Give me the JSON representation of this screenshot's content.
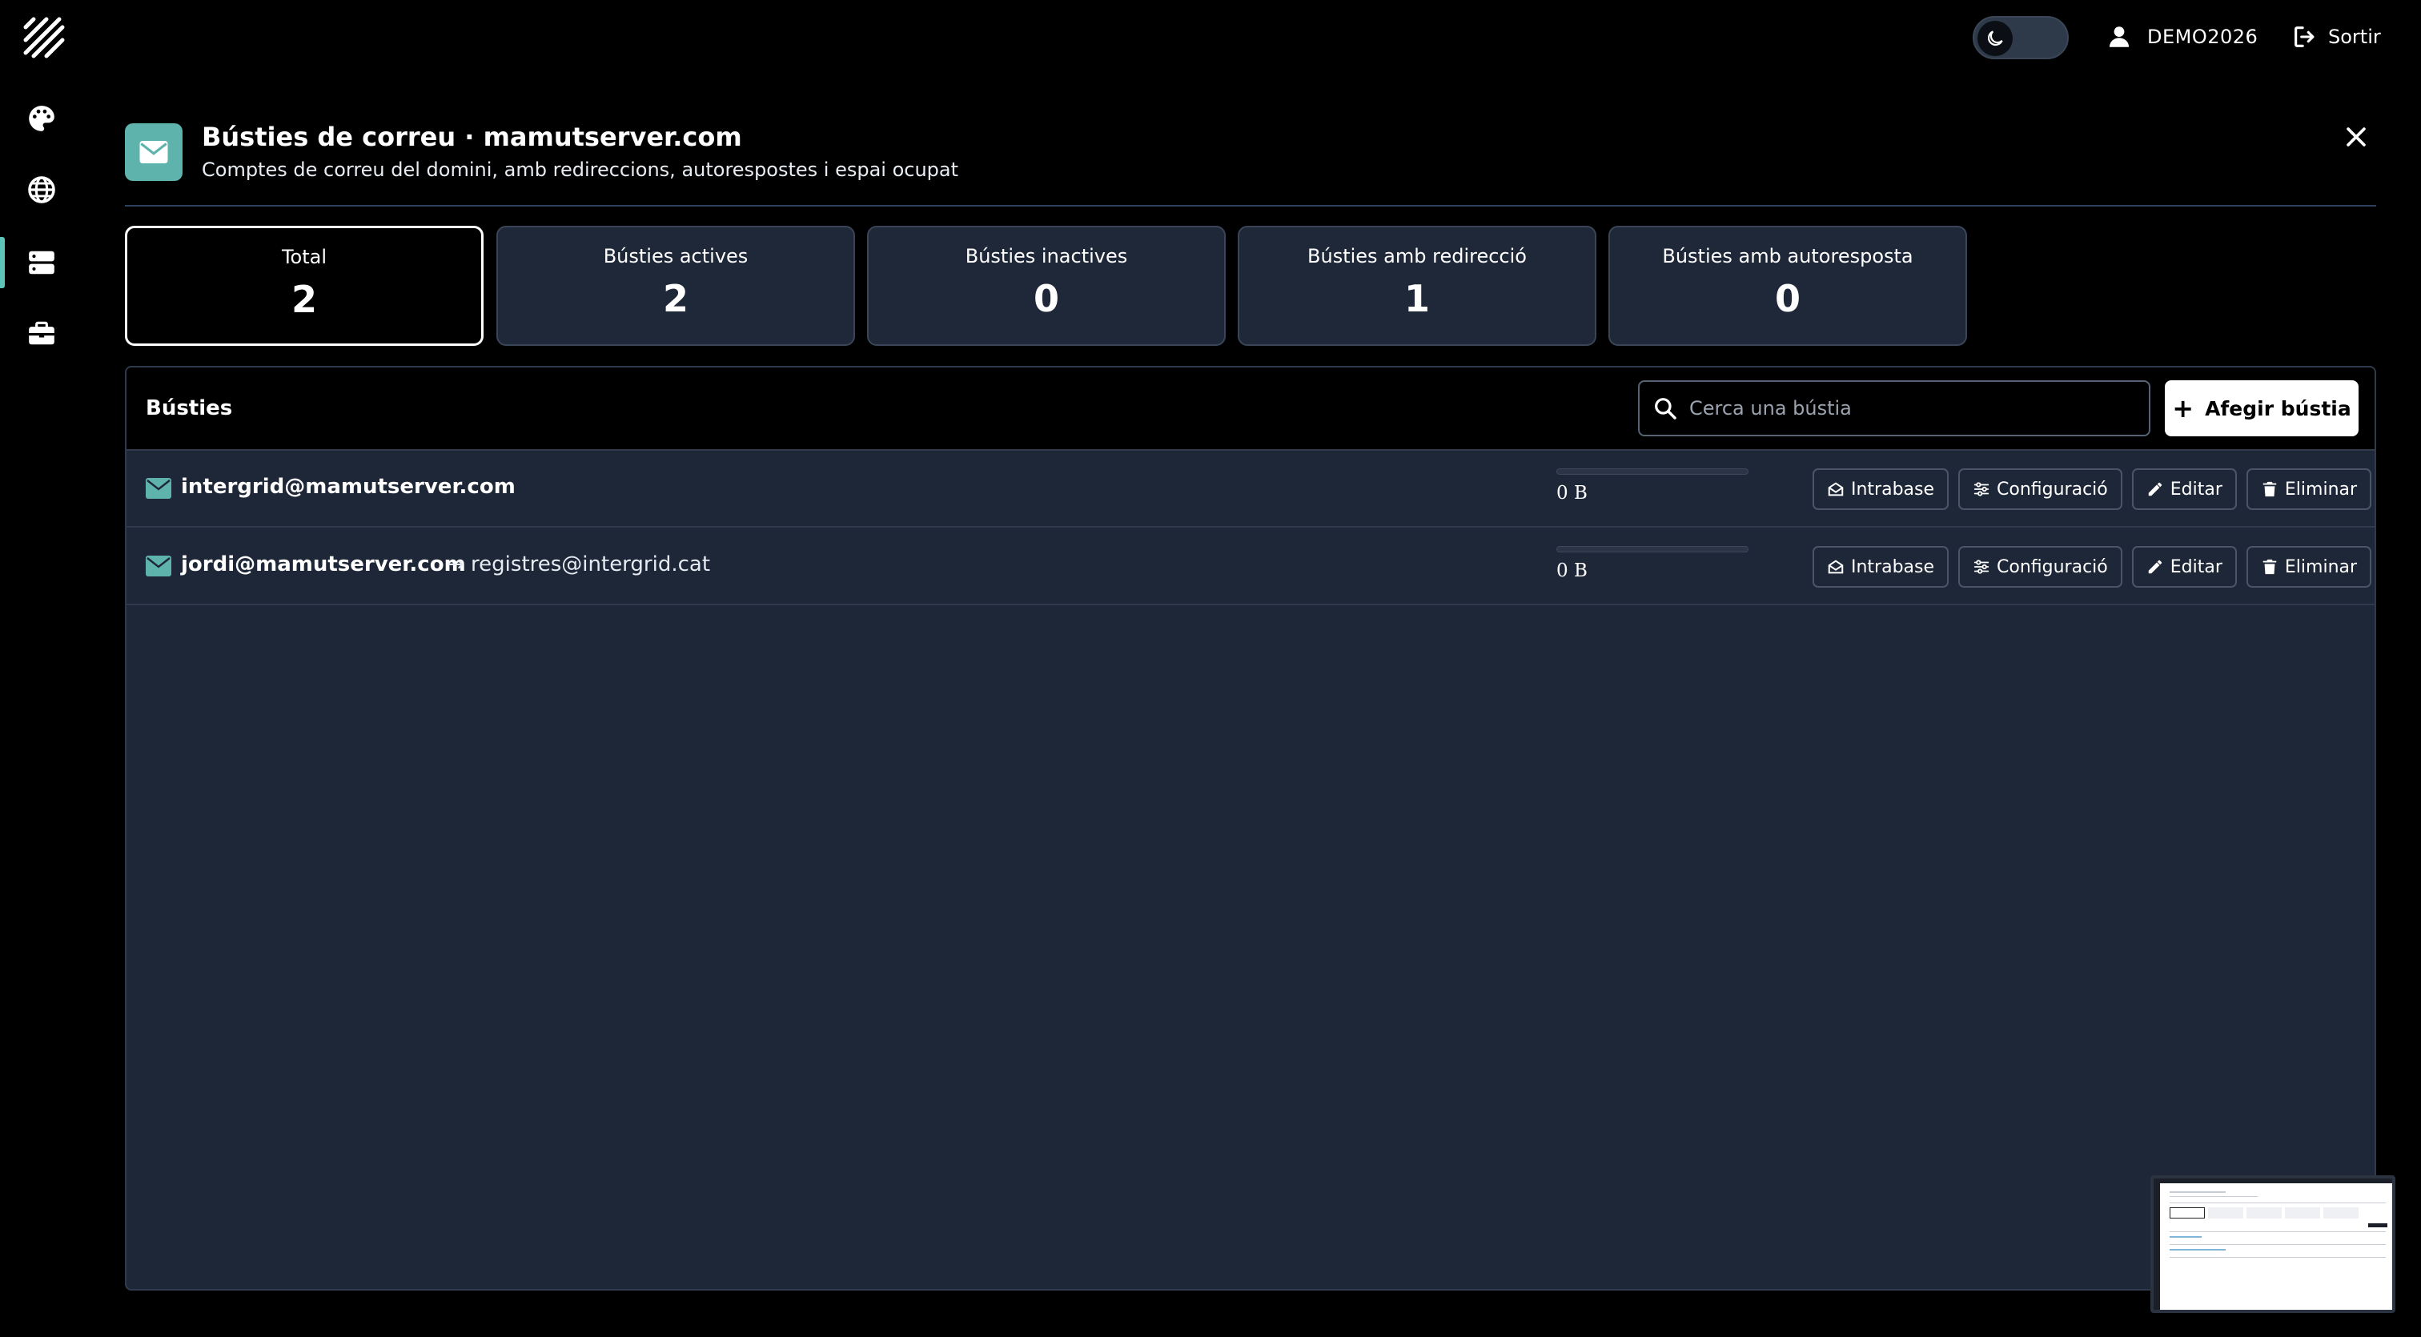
{
  "sidebar": {
    "logo": "brand-logo",
    "items": [
      {
        "icon": "palette-icon",
        "active": false
      },
      {
        "icon": "globe-icon",
        "active": false
      },
      {
        "icon": "server-icon",
        "active": true
      },
      {
        "icon": "briefcase-icon",
        "active": false
      }
    ]
  },
  "topbar": {
    "theme_toggle_icon": "moon-icon",
    "user_name": "DEMO2026",
    "logout_label": "Sortir"
  },
  "header": {
    "title": "Bústies de correu · mamutserver.com",
    "subtitle": "Comptes de correu del domini, amb redireccions, autorespostes i espai ocupat"
  },
  "stats": [
    {
      "label": "Total",
      "value": "2",
      "selected": true
    },
    {
      "label": "Bústies actives",
      "value": "2",
      "selected": false
    },
    {
      "label": "Bústies inactives",
      "value": "0",
      "selected": false
    },
    {
      "label": "Bústies amb redirecció",
      "value": "1",
      "selected": false
    },
    {
      "label": "Bústies amb autoresposta",
      "value": "0",
      "selected": false
    }
  ],
  "panel": {
    "title": "Bústies",
    "search_placeholder": "Cerca una bústia",
    "add_label": "Afegir bústia"
  },
  "actions": {
    "intrabase": "Intrabase",
    "config": "Configuració",
    "edit": "Editar",
    "delete": "Eliminar"
  },
  "mailboxes": [
    {
      "email": "intergrid@mamutserver.com",
      "forward": "",
      "usage": "0 B",
      "usage_fraction": 0
    },
    {
      "email": "jordi@mamutserver.com",
      "forward": "→ registres@intergrid.cat",
      "usage": "0 B",
      "usage_fraction": 0
    }
  ],
  "colors": {
    "accent": "#5fc4b8",
    "card_bg": "#1f2838",
    "panel_bg": "#1e2737"
  }
}
